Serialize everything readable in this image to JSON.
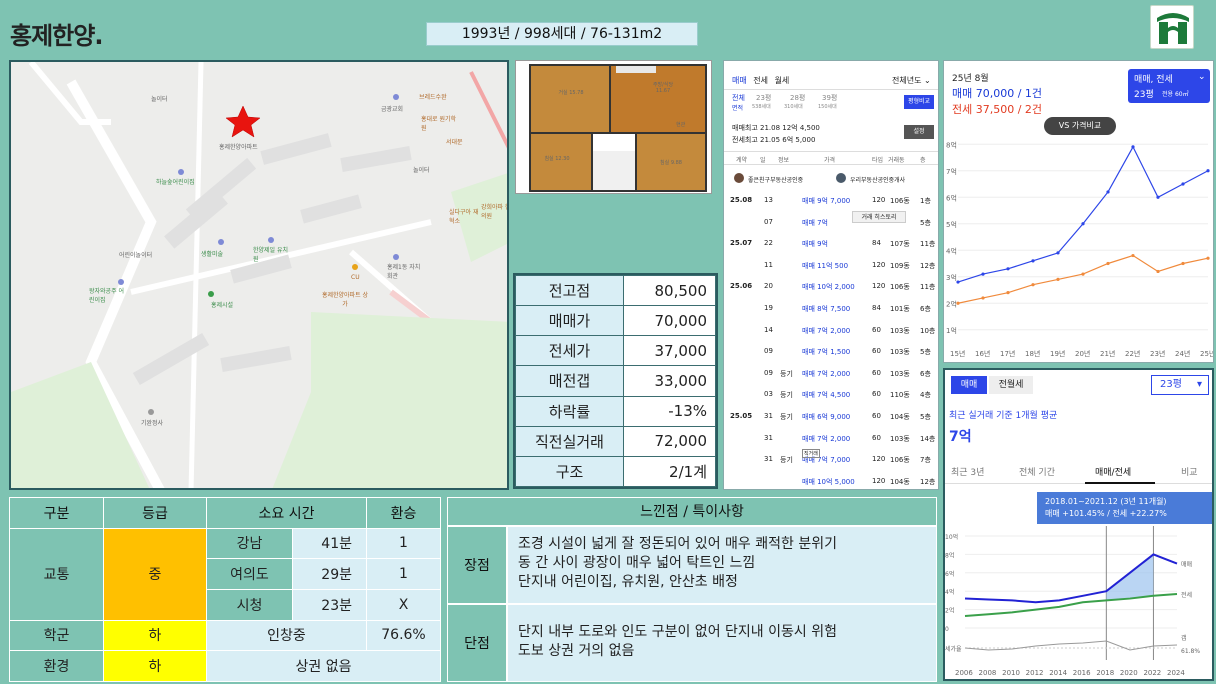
{
  "header": {
    "title": "홍제한양.",
    "summary": "1993년 / 998세대 / 76-131m2"
  },
  "map": {
    "labels": [
      {
        "text": "홍제한양아파트",
        "cls": ""
      },
      {
        "text": "놀이터",
        "cls": ""
      },
      {
        "text": "금광교회",
        "cls": ""
      },
      {
        "text": "브레드수완",
        "cls": "o"
      },
      {
        "text": "홍대로 원기학원",
        "cls": "o"
      },
      {
        "text": "서대문",
        "cls": "o"
      },
      {
        "text": "하늘숲어린이집",
        "cls": "g"
      },
      {
        "text": "어린이놀이터",
        "cls": ""
      },
      {
        "text": "생활미술",
        "cls": "g"
      },
      {
        "text": "한양제일 유치원",
        "cls": "g"
      },
      {
        "text": "홍제1동 자치회관",
        "cls": ""
      },
      {
        "text": "CU",
        "cls": "o"
      },
      {
        "text": "홍제한양아파트 상가",
        "cls": "o"
      },
      {
        "text": "왕자와공주 어린이집",
        "cls": "g"
      },
      {
        "text": "홍제시설",
        "cls": "g"
      },
      {
        "text": "실다구아 재혁소",
        "cls": "o"
      },
      {
        "text": "강희아파 한의원",
        "cls": "o"
      },
      {
        "text": "기완정사",
        "cls": ""
      },
      {
        "text": "놀이터",
        "cls": ""
      }
    ]
  },
  "floorplan": {
    "rooms": [
      "거실 15.78",
      "주방/식당 11.67",
      "침실 12.30",
      "침실 9.88",
      "현관"
    ]
  },
  "price_table": [
    {
      "label": "전고점",
      "value": "80,500"
    },
    {
      "label": "매매가",
      "value": "70,000"
    },
    {
      "label": "전세가",
      "value": "37,000"
    },
    {
      "label": "매전갭",
      "value": "33,000"
    },
    {
      "label": "하락률",
      "value": "-13%"
    },
    {
      "label": "직전실거래",
      "value": "72,000"
    },
    {
      "label": "구조",
      "value": "2/1계"
    }
  ],
  "transactions": {
    "tabs": [
      "매매",
      "전세",
      "월세"
    ],
    "filter": "전체년도",
    "sizes": [
      "전체",
      "23평",
      "28평",
      "39평"
    ],
    "size_sub": [
      "면적",
      "538세대",
      "310세대",
      "150세대"
    ],
    "compare_btn": "평형비교",
    "recent1": "매매최고 21.08 12억 4,500",
    "recent2": "전세최고 21.05 6억 5,000",
    "setting_btn": "설정",
    "columns": [
      "계약",
      "일",
      "정보",
      "가격",
      "타입",
      "거래동",
      "층"
    ],
    "agents": [
      "좋은친구부동산공인중",
      "우리부동산공인중개사"
    ],
    "tooltip": "거래 히스토리",
    "rows": [
      {
        "ym": "25.08",
        "d": "13",
        "tag": "",
        "price": "매매 9억 7,000",
        "type": "120",
        "dong": "106동",
        "fl": "1층"
      },
      {
        "ym": "",
        "d": "07",
        "tag": "",
        "price": "매매 7억",
        "type": "",
        "dong": "",
        "fl": "5층"
      },
      {
        "ym": "25.07",
        "d": "22",
        "tag": "",
        "price": "매매 9억",
        "type": "84",
        "dong": "107동",
        "fl": "11층"
      },
      {
        "ym": "",
        "d": "11",
        "tag": "",
        "price": "매매 11억 500",
        "type": "120",
        "dong": "109동",
        "fl": "12층"
      },
      {
        "ym": "25.06",
        "d": "20",
        "tag": "",
        "price": "매매 10억 2,000",
        "type": "120",
        "dong": "106동",
        "fl": "11층"
      },
      {
        "ym": "",
        "d": "19",
        "tag": "",
        "price": "매매 8억 7,500",
        "type": "84",
        "dong": "101동",
        "fl": "6층"
      },
      {
        "ym": "",
        "d": "14",
        "tag": "",
        "price": "매매 7억 2,000",
        "type": "60",
        "dong": "103동",
        "fl": "10층"
      },
      {
        "ym": "",
        "d": "09",
        "tag": "",
        "price": "매매 7억 1,500",
        "type": "60",
        "dong": "103동",
        "fl": "5층"
      },
      {
        "ym": "",
        "d": "09",
        "tag": "등기",
        "price": "매매 7억 2,000",
        "type": "60",
        "dong": "103동",
        "fl": "6층"
      },
      {
        "ym": "",
        "d": "03",
        "tag": "등기",
        "price": "매매 7억 4,500",
        "type": "60",
        "dong": "110동",
        "fl": "4층"
      },
      {
        "ym": "25.05",
        "d": "31",
        "tag": "등기",
        "price": "매매 6억 9,000",
        "type": "60",
        "dong": "104동",
        "fl": "5층"
      },
      {
        "ym": "",
        "d": "31",
        "tag": "",
        "price": "매매 7억 2,000",
        "type": "60",
        "dong": "103동",
        "fl": "14층"
      },
      {
        "ym": "",
        "d": "31",
        "tag": "등기",
        "price": "매매 7억 7,000",
        "type": "120",
        "dong": "106동",
        "fl": "7층"
      },
      {
        "ym": "",
        "d": "",
        "tag": "",
        "price": "매매 10억 5,000",
        "type": "120",
        "dong": "104동",
        "fl": "12층"
      }
    ],
    "small_tag": "직거래"
  },
  "price_chart": {
    "date": "25년 8월",
    "sale": "매매 70,000 / 1건",
    "jeonse": "전세 37,500 / 2건",
    "selector_top": "매매, 전세",
    "selector_bottom": "23평",
    "selector_note": "전용 60㎡",
    "compare": "VS 가격비교",
    "chart_data": {
      "type": "line",
      "ylabel": "",
      "x": [
        "15년",
        "16년",
        "17년",
        "18년",
        "19년",
        "20년",
        "21년",
        "22년",
        "23년",
        "24년",
        "25년"
      ],
      "yticks": [
        "1억",
        "2억",
        "3억",
        "4억",
        "5억",
        "6억",
        "7억",
        "8억"
      ],
      "ylim": [
        0.5,
        8.5
      ],
      "series": [
        {
          "values": [
            2.8,
            3.1,
            3.3,
            3.6,
            3.9,
            5.0,
            6.2,
            7.9,
            6.0,
            6.5,
            7.0
          ]
        },
        {
          "values": [
            2.0,
            2.2,
            2.4,
            2.7,
            2.9,
            3.1,
            3.5,
            3.8,
            3.2,
            3.5,
            3.7
          ]
        }
      ]
    }
  },
  "comparison": {
    "tabs": [
      "매매",
      "전월세"
    ],
    "size": "23평",
    "subtitle": "최근 실거래 기준 1개월 평균",
    "price": "7억",
    "range_tabs": [
      "최근 3년",
      "전체 기간",
      "매매/전세",
      "비교"
    ],
    "tooltip_line1": "2018.01~2021.12 (3년 11개월)",
    "tooltip_line2": "매매 +101.45%  /  전세 +22.27%",
    "series_labels": [
      "매매",
      "전세",
      "갭",
      "61.8%"
    ],
    "gap_label": "세가율",
    "chart_data": {
      "type": "area",
      "x": [
        "2006",
        "2008",
        "2010",
        "2012",
        "2014",
        "2016",
        "2018",
        "2020",
        "2022",
        "2024"
      ],
      "yticks": [
        "0",
        "2억",
        "4억",
        "6억",
        "8억",
        "10억"
      ],
      "ylim": [
        0,
        10
      ],
      "series": [
        {
          "name": "매매",
          "values": [
            3.2,
            3.1,
            3.0,
            2.8,
            3.0,
            3.5,
            4.0,
            6.0,
            8.0,
            7.0
          ]
        },
        {
          "name": "전세",
          "values": [
            1.3,
            1.5,
            1.7,
            2.0,
            2.3,
            2.8,
            3.0,
            3.2,
            3.5,
            3.7
          ]
        }
      ]
    }
  },
  "info": {
    "headers": [
      "구분",
      "등급",
      "소요 시간",
      "환승"
    ],
    "traffic_label": "교통",
    "traffic_grade": "중",
    "commute": [
      {
        "place": "강남",
        "time": "41분",
        "transfer": "1"
      },
      {
        "place": "여의도",
        "time": "29분",
        "transfer": "1"
      },
      {
        "place": "시청",
        "time": "23분",
        "transfer": "X"
      }
    ],
    "school_label": "학군",
    "school_grade": "하",
    "school_name": "인창중",
    "school_rate": "76.6%",
    "env_label": "환경",
    "env_grade": "하",
    "env_note": "상권 없음"
  },
  "notes": {
    "header": "느낀점  /  특이사항",
    "pros_label": "장점",
    "pros": [
      "조경 시설이 넓게 잘 정돈되어 있어 매우 쾌적한 분위기",
      "동 간 사이 광장이 매우 넓어 탁트인 느낌",
      "단지내 어린이집, 유치원, 안산초 배정"
    ],
    "cons_label": "단점",
    "cons": [
      "단지 내부 도로와 인도 구분이 없어 단지내 이동시 위험",
      "도보 상권 거의 없음"
    ]
  }
}
